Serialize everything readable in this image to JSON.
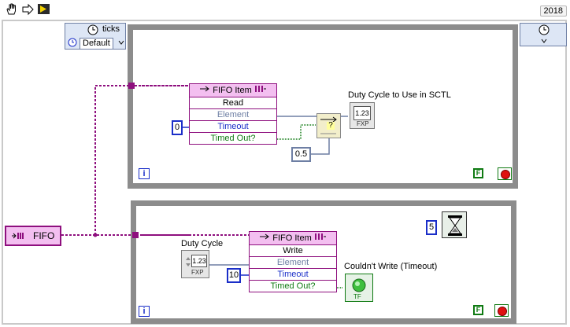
{
  "toolbar": {
    "version_label": "2018",
    "icons": [
      "hand-grab-icon",
      "run-arrow-icon",
      "step-run-icon"
    ]
  },
  "timed_structure": {
    "source_label": "ticks",
    "source_value": "Default"
  },
  "queue_control": {
    "label": "FIFO"
  },
  "read_node": {
    "title": "FIFO Item",
    "mode": "Read",
    "terminals": [
      "Element",
      "Timeout",
      "Timed Out?"
    ],
    "timeout_value": "0"
  },
  "select_node": {
    "false_value": "0.5",
    "symbol": "?"
  },
  "read_output": {
    "label": "Duty Cycle to Use in SCTL",
    "type_text": "1.23",
    "sub_text": "FXP"
  },
  "write_node": {
    "title": "FIFO Item",
    "mode": "Write",
    "terminals": [
      "Element",
      "Timeout",
      "Timed Out?"
    ],
    "timeout_value": "10"
  },
  "write_input": {
    "label": "Duty Cycle",
    "type_text": "1.23",
    "sub_text": "FXP"
  },
  "write_output": {
    "label": "Couldn't Write (Timeout)",
    "sub_text": "TF"
  },
  "wait_node": {
    "value": "5"
  },
  "loop_markers": {
    "iteration": "i",
    "stop_false": "F"
  },
  "colors": {
    "fifo_pink": "#f3bff0",
    "fifo_border": "#8e0f7e",
    "wire_purple": "#8e0f7e",
    "numeric_blue": "#1a2ec8",
    "boolean_green": "#0f7a12",
    "fxp_wire": "#6e7fa4",
    "loop_gray": "#8c8c8c"
  }
}
